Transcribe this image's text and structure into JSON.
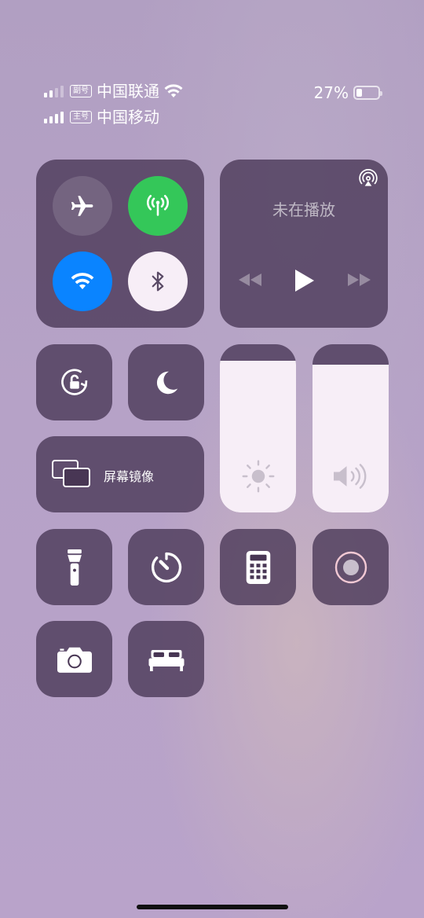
{
  "status": {
    "sim2": {
      "tag": "副号",
      "carrier": "中国联通",
      "signal_bars": 2
    },
    "sim1": {
      "tag": "主号",
      "carrier": "中国移动",
      "signal_bars": 4
    },
    "battery_text": "27%",
    "battery_level": 0.27
  },
  "connectivity": {
    "airplane_mode": {
      "icon": "airplane-icon",
      "active": false
    },
    "cellular_data": {
      "icon": "antenna-icon",
      "active": true,
      "color": "#34c759"
    },
    "wifi": {
      "icon": "wifi-icon",
      "active": true,
      "color": "#0a84ff"
    },
    "bluetooth": {
      "icon": "bluetooth-icon",
      "active": true,
      "color": "#f7eef7"
    }
  },
  "media": {
    "title": "未在播放",
    "airplay_icon": "airplay-icon",
    "rewind_icon": "rewind-icon",
    "play_icon": "play-icon",
    "forward_icon": "fast-forward-icon"
  },
  "controls": {
    "rotation_lock_icon": "rotation-lock-icon",
    "do_not_disturb_icon": "moon-icon",
    "screen_mirroring": {
      "label": "屏幕镜像",
      "icon": "screen-mirroring-icon"
    },
    "brightness": {
      "icon": "sun-icon",
      "level": 0.9
    },
    "volume": {
      "icon": "speaker-icon",
      "level": 0.88
    },
    "flashlight_icon": "flashlight-icon",
    "timer_icon": "timer-icon",
    "calculator_icon": "calculator-icon",
    "screen_record_icon": "record-icon",
    "camera_icon": "camera-icon",
    "sleep_icon": "bed-icon"
  }
}
